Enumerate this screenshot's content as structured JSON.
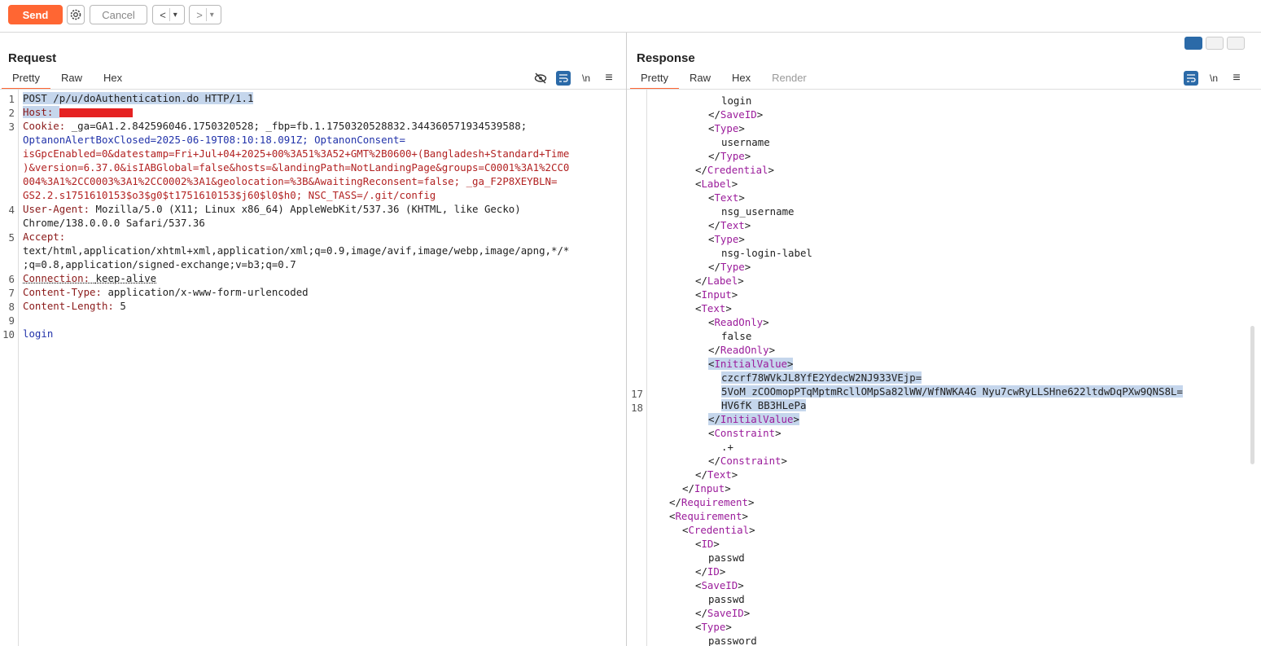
{
  "toolbar": {
    "send_label": "Send",
    "cancel_label": "Cancel",
    "back_label": "<",
    "forward_label": ">",
    "dropdown_glyph": "▾"
  },
  "request": {
    "title": "Request",
    "tabs": [
      "Pretty",
      "Raw",
      "Hex"
    ],
    "line_numbers": [
      "1",
      "2",
      "3",
      "4",
      "5",
      "6",
      "7",
      "8",
      "9",
      "10"
    ],
    "lines": {
      "l1": "POST /p/u/doAuthentication.do HTTP/1.1",
      "l2_key": "Host: ",
      "l3a_key": "Cookie: ",
      "l3a_rest": "_ga=GA1.2.842596046.1750320528; _fbp=fb.1.1750320528832.344360571934539588;",
      "l3b": "OptanonAlertBoxClosed=2025-06-19T08:10:18.091Z; OptanonConsent=",
      "l3c": "isGpcEnabled=0&datestamp=Fri+Jul+04+2025+00%3A51%3A52+GMT%2B0600+(Bangladesh+Standard+Time",
      "l3d": ")&version=6.37.0&isIABGlobal=false&hosts=&landingPath=NotLandingPage&groups=C0001%3A1%2CC0",
      "l3e": "004%3A1%2CC0003%3A1%2CC0002%3A1&geolocation=%3B&AwaitingReconsent=false; _ga_F2P8XEYBLN=",
      "l3f": "GS2.2.s1751610153$o3$g0$t1751610153$j60$l0$h0; NSC_TASS=/.git/config",
      "l4a_key": "User-Agent: ",
      "l4a_val": "Mozilla/5.0 (X11; Linux x86_64) AppleWebKit/537.36 (KHTML, like Gecko)",
      "l4b": "Chrome/138.0.0.0 Safari/537.36",
      "l5a_key": "Accept:",
      "l5b": "text/html,application/xhtml+xml,application/xml;q=0.9,image/avif,image/webp,image/apng,*/*",
      "l5c": ";q=0.8,application/signed-exchange;v=b3;q=0.7",
      "l6_key": "Connection: ",
      "l6_val": "keep-alive",
      "l7_key": "Content-Type: ",
      "l7_val": "application/x-www-form-urlencoded",
      "l8_key": "Content-Length: ",
      "l8_val": "5",
      "l10": "login"
    }
  },
  "response": {
    "title": "Response",
    "tabs": [
      "Pretty",
      "Raw",
      "Hex",
      "Render"
    ],
    "line_numbers": [
      "17",
      "18"
    ],
    "lines": [
      {
        "indent": 7,
        "text": "login",
        "kind": "text"
      },
      {
        "indent": 6,
        "text": "SaveID",
        "kind": "close"
      },
      {
        "indent": 6,
        "text": "Type",
        "kind": "open"
      },
      {
        "indent": 7,
        "text": "username",
        "kind": "text"
      },
      {
        "indent": 6,
        "text": "Type",
        "kind": "close"
      },
      {
        "indent": 5,
        "text": "Credential",
        "kind": "close"
      },
      {
        "indent": 5,
        "text": "Label",
        "kind": "open"
      },
      {
        "indent": 6,
        "text": "Text",
        "kind": "open"
      },
      {
        "indent": 7,
        "text": "nsg_username",
        "kind": "text"
      },
      {
        "indent": 6,
        "text": "Text",
        "kind": "close"
      },
      {
        "indent": 6,
        "text": "Type",
        "kind": "open"
      },
      {
        "indent": 7,
        "text": "nsg-login-label",
        "kind": "text"
      },
      {
        "indent": 6,
        "text": "Type",
        "kind": "close"
      },
      {
        "indent": 5,
        "text": "Label",
        "kind": "close"
      },
      {
        "indent": 5,
        "text": "Input",
        "kind": "open"
      },
      {
        "indent": 5,
        "text": "Text",
        "kind": "open"
      },
      {
        "indent": 6,
        "text": "ReadOnly",
        "kind": "open"
      },
      {
        "indent": 7,
        "text": "false",
        "kind": "text"
      },
      {
        "indent": 6,
        "text": "ReadOnly",
        "kind": "close"
      },
      {
        "indent": 6,
        "text": "InitialValue",
        "kind": "open",
        "hl": true
      },
      {
        "indent": 7,
        "text": "czcrf78WVkJL8YfE2YdecW2NJ933VEjp=",
        "kind": "text",
        "hl": true
      },
      {
        "indent": 7,
        "text": "5VoM zCOOmopPTqMptmRcllOMpSa82lWW/WfNWKA4G Nyu7cwRyLLSHne622ltdwDqPXw9QNS8L=",
        "kind": "text",
        "hl": true
      },
      {
        "indent": 7,
        "text": "HV6fK BB3HLePa",
        "kind": "text",
        "hl": true
      },
      {
        "indent": 6,
        "text": "InitialValue",
        "kind": "close",
        "hl": true
      },
      {
        "indent": 6,
        "text": "Constraint",
        "kind": "open"
      },
      {
        "indent": 7,
        "text": ".+",
        "kind": "text"
      },
      {
        "indent": 6,
        "text": "Constraint",
        "kind": "close"
      },
      {
        "indent": 5,
        "text": "Text",
        "kind": "close"
      },
      {
        "indent": 4,
        "text": "Input",
        "kind": "close"
      },
      {
        "indent": 3,
        "text": "Requirement",
        "kind": "close"
      },
      {
        "indent": 3,
        "text": "Requirement",
        "kind": "open"
      },
      {
        "indent": 4,
        "text": "Credential",
        "kind": "open"
      },
      {
        "indent": 5,
        "text": "ID",
        "kind": "open"
      },
      {
        "indent": 6,
        "text": "passwd",
        "kind": "text"
      },
      {
        "indent": 5,
        "text": "ID",
        "kind": "close"
      },
      {
        "indent": 5,
        "text": "SaveID",
        "kind": "open"
      },
      {
        "indent": 6,
        "text": "passwd",
        "kind": "text"
      },
      {
        "indent": 5,
        "text": "SaveID",
        "kind": "close"
      },
      {
        "indent": 5,
        "text": "Type",
        "kind": "open"
      },
      {
        "indent": 6,
        "text": "password",
        "kind": "text"
      }
    ]
  },
  "icons": {
    "gear": "gear-icon",
    "hide": "eye-slash-icon",
    "wrap": "wrap-icon",
    "newline": "\\n",
    "menu": "≡"
  },
  "colors": {
    "accent": "#ff6633",
    "selection": "#c5d6ec",
    "tag": "#9b1c9b",
    "toggle": "#2b6aa8"
  }
}
